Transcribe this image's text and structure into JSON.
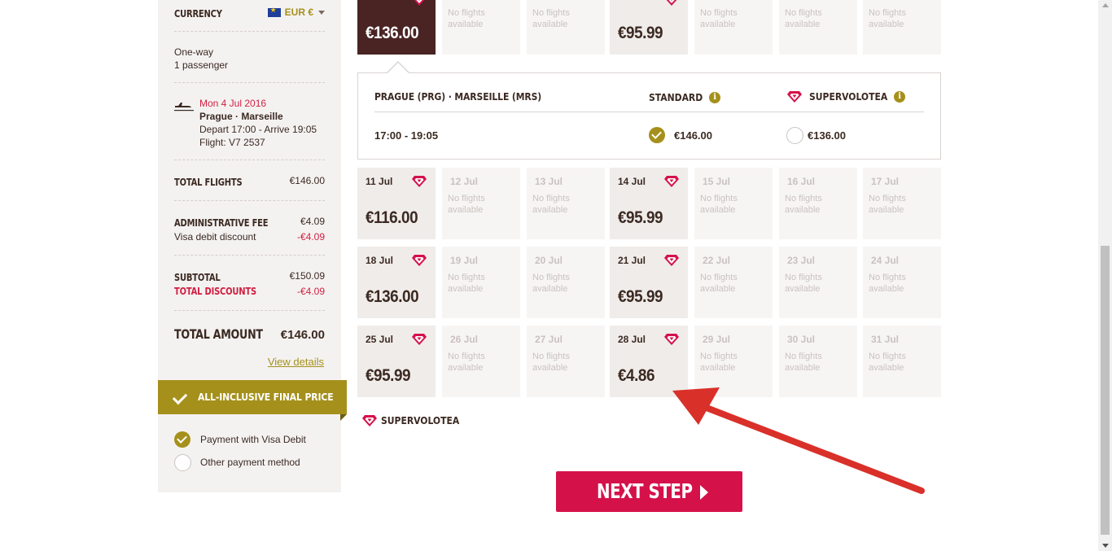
{
  "summary": {
    "currency_label": "CURRENCY",
    "currency_value": "EUR €",
    "trip_type": "One-way",
    "passengers": "1 passenger",
    "flight_date": "Mon 4 Jul 2016",
    "route": "Prague · Marseille",
    "times": "Depart 17:00 - Arrive 19:05",
    "flight_no": "Flight: V7 2537",
    "total_flights_label": "TOTAL FLIGHTS",
    "total_flights_value": "€146.00",
    "admin_fee_label": "ADMINISTRATIVE FEE",
    "admin_fee_value": "€4.09",
    "visa_discount_label": "Visa debit discount",
    "visa_discount_value": "-€4.09",
    "subtotal_label": "SUBTOTAL",
    "subtotal_value": "€150.09",
    "total_discounts_label": "TOTAL DISCOUNTS",
    "total_discounts_value": "-€4.09",
    "total_amount_label": "TOTAL AMOUNT",
    "total_amount_value": "€146.00",
    "view_details": "View details",
    "banner": "ALL-INCLUSIVE FINAL PRICE",
    "payment_visa": "Payment with Visa Debit",
    "payment_other": "Other payment method"
  },
  "calendar": {
    "no_flights": "No flights available",
    "top_row": [
      {
        "date": "",
        "price": "€136.00",
        "selected": true,
        "has_flight": true
      },
      {
        "date": "",
        "price": "",
        "has_flight": false
      },
      {
        "date": "",
        "price": "",
        "has_flight": false
      },
      {
        "date": "",
        "price": "€95.99",
        "has_flight": true
      },
      {
        "date": "",
        "price": "",
        "has_flight": false
      },
      {
        "date": "",
        "price": "",
        "has_flight": false
      },
      {
        "date": "",
        "price": "",
        "has_flight": false
      }
    ],
    "rows": [
      [
        {
          "date": "11 Jul",
          "price": "€116.00",
          "has_flight": true
        },
        {
          "date": "12 Jul",
          "has_flight": false
        },
        {
          "date": "13 Jul",
          "has_flight": false
        },
        {
          "date": "14 Jul",
          "price": "€95.99",
          "has_flight": true
        },
        {
          "date": "15 Jul",
          "has_flight": false
        },
        {
          "date": "16 Jul",
          "has_flight": false
        },
        {
          "date": "17 Jul",
          "has_flight": false
        }
      ],
      [
        {
          "date": "18 Jul",
          "price": "€136.00",
          "has_flight": true
        },
        {
          "date": "19 Jul",
          "has_flight": false
        },
        {
          "date": "20 Jul",
          "has_flight": false
        },
        {
          "date": "21 Jul",
          "price": "€95.99",
          "has_flight": true
        },
        {
          "date": "22 Jul",
          "has_flight": false
        },
        {
          "date": "23 Jul",
          "has_flight": false
        },
        {
          "date": "24 Jul",
          "has_flight": false
        }
      ],
      [
        {
          "date": "25 Jul",
          "price": "€95.99",
          "has_flight": true
        },
        {
          "date": "26 Jul",
          "has_flight": false
        },
        {
          "date": "27 Jul",
          "has_flight": false
        },
        {
          "date": "28 Jul",
          "price": "€4.86",
          "has_flight": true
        },
        {
          "date": "29 Jul",
          "has_flight": false
        },
        {
          "date": "30 Jul",
          "has_flight": false
        },
        {
          "date": "31 Jul",
          "has_flight": false
        }
      ]
    ]
  },
  "detail": {
    "route": "PRAGUE (PRG) · MARSEILLE (MRS)",
    "standard_label": "STANDARD",
    "super_label": "SUPERVOLOTEA",
    "times": "17:00 - 19:05",
    "standard_price": "€146.00",
    "super_price": "€136.00"
  },
  "legend": {
    "super_label": "SUPERVOLOTEA"
  },
  "next_step": "NEXT STEP",
  "colors": {
    "gold": "#a5901b",
    "brand_red": "#d5114a",
    "dark_maroon": "#4a2323",
    "annotation_arrow": "#d9302a"
  }
}
